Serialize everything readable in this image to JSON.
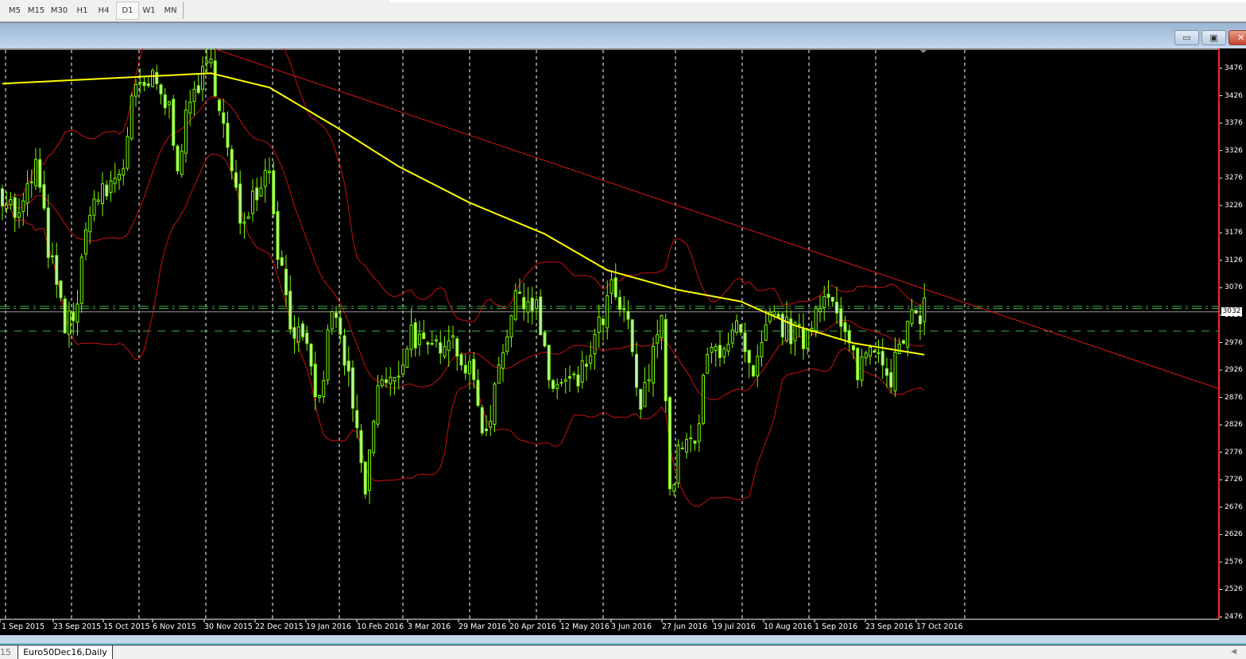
{
  "toolbar": {
    "timeframes": [
      "M5",
      "M15",
      "M30",
      "H1",
      "H4",
      "D1",
      "W1",
      "MN"
    ],
    "active_timeframe": "D1"
  },
  "window": {
    "minimize_icon": "minimize-icon",
    "restore_icon": "restore-icon",
    "close_icon": "close-icon",
    "minimize_glyph": "▭",
    "restore_glyph": "▣",
    "close_glyph": "✕"
  },
  "price_axis": {
    "labels": [
      "3476",
      "3426",
      "3376",
      "3326",
      "3276",
      "3226",
      "3176",
      "3126",
      "3076",
      "3026",
      "2976",
      "2926",
      "2876",
      "2826",
      "2776",
      "2726",
      "2676",
      "2626",
      "2576",
      "2526",
      "2476"
    ],
    "current_price": "3032"
  },
  "time_axis": {
    "labels": [
      "1 Sep 2015",
      "23 Sep 2015",
      "15 Oct 2015",
      "6 Nov 2015",
      "30 Nov 2015",
      "22 Dec 2015",
      "19 Jan 2016",
      "10 Feb 2016",
      "3 Mar 2016",
      "29 Mar 2016",
      "20 Apr 2016",
      "12 May 2016",
      "3 Jun 2016",
      "27 Jun 2016",
      "19 Jul 2016",
      "10 Aug 2016",
      "1 Sep 2016",
      "23 Sep 2016",
      "17 Oct 2016"
    ]
  },
  "tabs": {
    "previous_partial": "15",
    "active": "Euro50Dec16,Daily",
    "scroll_glyph": "◀"
  },
  "colors": {
    "background": "#000000",
    "candles": "#7cfc00",
    "moving_average": "#ffff00",
    "bands": "#cc1010",
    "trendline": "#dd1818",
    "levels": "#3cb043"
  },
  "chart_data": {
    "type": "candlestick",
    "symbol": "Euro50Dec16",
    "timeframe": "Daily",
    "ylim": [
      2476,
      3476
    ],
    "close_waypoints": [
      [
        0,
        3250
      ],
      [
        4,
        3200
      ],
      [
        8,
        3300
      ],
      [
        11,
        3150
      ],
      [
        15,
        3000
      ],
      [
        18,
        3050
      ],
      [
        21,
        3230
      ],
      [
        25,
        3250
      ],
      [
        29,
        3300
      ],
      [
        31,
        3420
      ],
      [
        36,
        3450
      ],
      [
        40,
        3400
      ],
      [
        42,
        3310
      ],
      [
        46,
        3440
      ],
      [
        50,
        3480
      ],
      [
        52,
        3420
      ],
      [
        54,
        3320
      ],
      [
        57,
        3200
      ],
      [
        61,
        3260
      ],
      [
        64,
        3300
      ],
      [
        66,
        3150
      ],
      [
        69,
        3020
      ],
      [
        73,
        2950
      ],
      [
        76,
        2860
      ],
      [
        79,
        3040
      ],
      [
        82,
        2950
      ],
      [
        84,
        2850
      ],
      [
        87,
        2700
      ],
      [
        90,
        2900
      ],
      [
        94,
        2900
      ],
      [
        98,
        3000
      ],
      [
        102,
        2950
      ],
      [
        107,
        3000
      ],
      [
        113,
        2900
      ],
      [
        116,
        2800
      ],
      [
        119,
        2950
      ],
      [
        124,
        3070
      ],
      [
        128,
        3040
      ],
      [
        131,
        2900
      ],
      [
        138,
        2900
      ],
      [
        143,
        3000
      ],
      [
        146,
        3070
      ],
      [
        150,
        3000
      ],
      [
        153,
        2850
      ],
      [
        156,
        2950
      ],
      [
        158,
        3050
      ],
      [
        160,
        2700
      ],
      [
        163,
        2800
      ],
      [
        166,
        2780
      ],
      [
        169,
        2950
      ],
      [
        176,
        3000
      ],
      [
        180,
        2900
      ],
      [
        184,
        3020
      ],
      [
        188,
        3000
      ],
      [
        192,
        2980
      ],
      [
        197,
        3080
      ],
      [
        201,
        3000
      ],
      [
        205,
        2930
      ],
      [
        209,
        2980
      ],
      [
        213,
        2920
      ],
      [
        217,
        3000
      ],
      [
        221,
        3045
      ]
    ],
    "moving_average_waypoints": [
      [
        0,
        3448
      ],
      [
        50,
        3467
      ],
      [
        64,
        3441
      ],
      [
        80,
        3369
      ],
      [
        95,
        3297
      ],
      [
        112,
        3231
      ],
      [
        130,
        3174
      ],
      [
        145,
        3108
      ],
      [
        162,
        3072
      ],
      [
        177,
        3051
      ],
      [
        190,
        3007
      ],
      [
        204,
        2975
      ],
      [
        221,
        2954
      ]
    ],
    "trendline": [
      [
        51,
        3511
      ],
      [
        292,
        2891
      ]
    ],
    "levels": [
      {
        "price": 3042,
        "style": "dash-dot"
      },
      {
        "price": 3038,
        "style": "dash-dot"
      },
      {
        "price": 3032,
        "style": "solid-gray"
      },
      {
        "price": 2997,
        "style": "dashed"
      }
    ],
    "bollinger_period": 20,
    "bollinger_deviation": 2
  }
}
